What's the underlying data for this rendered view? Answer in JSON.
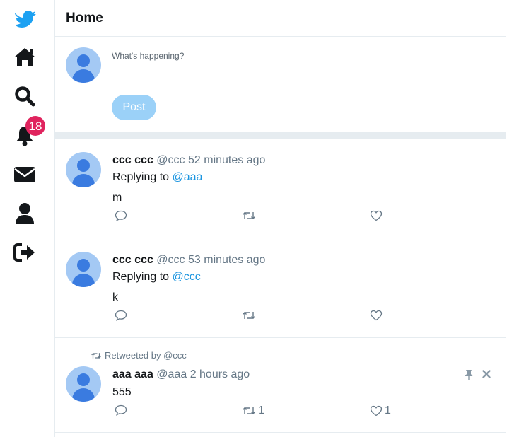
{
  "sidebar": {
    "items": [
      {
        "name": "logo-icon"
      },
      {
        "name": "home-icon"
      },
      {
        "name": "search-icon"
      },
      {
        "name": "notifications-icon",
        "badge": "18"
      },
      {
        "name": "messages-icon"
      },
      {
        "name": "profile-icon"
      },
      {
        "name": "logout-icon"
      }
    ],
    "badge_color": "#e0245e",
    "brand_color": "#1da1f2"
  },
  "header": {
    "title": "Home"
  },
  "compose": {
    "placeholder": "What's happening?",
    "post_label": "Post"
  },
  "tweets": [
    {
      "name": "ccc ccc",
      "handle": "@ccc",
      "time": "52 minutes ago",
      "replying_prefix": "Replying to",
      "replying_to": "@aaa",
      "text": "m"
    },
    {
      "name": "ccc ccc",
      "handle": "@ccc",
      "time": "53 minutes ago",
      "replying_prefix": "Replying to",
      "replying_to": "@ccc",
      "text": "k"
    },
    {
      "retweeted_by": "Retweeted by @ccc",
      "name": "aaa aaa",
      "handle": "@aaa",
      "time": "2 hours ago",
      "text": "555",
      "retweet_count": "1",
      "like_count": "1"
    }
  ]
}
